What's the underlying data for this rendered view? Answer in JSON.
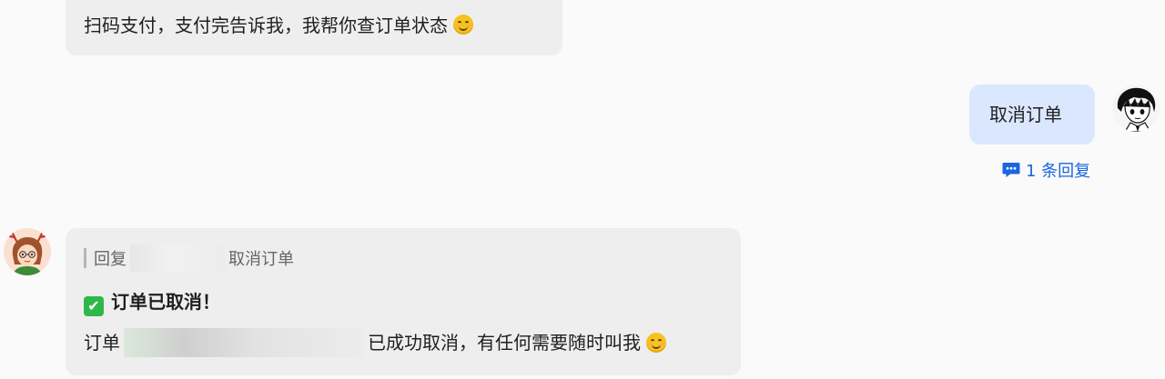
{
  "messages": {
    "bot_top": {
      "text": "扫码支付，支付完告诉我，我帮你查订单状态",
      "emoji": "smiling-face-emoji"
    },
    "user": {
      "text": "取消订单",
      "reply_count_label": "1 条回复"
    },
    "bot_reply": {
      "quote_prefix": "回复",
      "quote_text": "取消订单",
      "title": "订单已取消！",
      "check_icon": "✔",
      "body_prefix": "订单",
      "body_suffix": "已成功取消，有任何需要随时叫我",
      "emoji": "smiling-face-emoji"
    }
  },
  "colors": {
    "left_bubble": "#eeeeef",
    "right_bubble": "#dbe7ff",
    "link": "#1a66e0",
    "check": "#2fb84a"
  }
}
